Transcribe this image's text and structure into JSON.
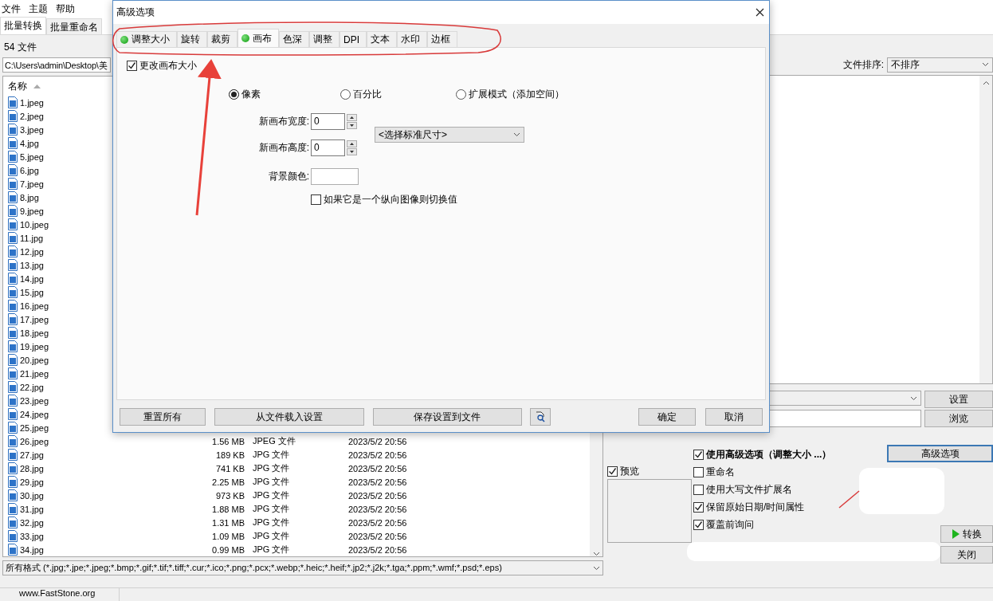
{
  "menu": [
    "文件",
    "主题",
    "帮助"
  ],
  "main_tabs": [
    {
      "label": "批量转换",
      "selected": true
    },
    {
      "label": "批量重命名",
      "selected": false
    }
  ],
  "file_count": "54 文件",
  "path": "C:\\Users\\admin\\Desktop\\美",
  "file_list": {
    "name_column": "名称",
    "rows": [
      {
        "name": "1.jpeg"
      },
      {
        "name": "2.jpeg"
      },
      {
        "name": "3.jpeg"
      },
      {
        "name": "4.jpg"
      },
      {
        "name": "5.jpeg"
      },
      {
        "name": "6.jpg"
      },
      {
        "name": "7.jpeg"
      },
      {
        "name": "8.jpg"
      },
      {
        "name": "9.jpeg"
      },
      {
        "name": "10.jpeg"
      },
      {
        "name": "11.jpg"
      },
      {
        "name": "12.jpg"
      },
      {
        "name": "13.jpg"
      },
      {
        "name": "14.jpg"
      },
      {
        "name": "15.jpg"
      },
      {
        "name": "16.jpeg"
      },
      {
        "name": "17.jpeg"
      },
      {
        "name": "18.jpeg"
      },
      {
        "name": "19.jpeg"
      },
      {
        "name": "20.jpeg"
      },
      {
        "name": "21.jpeg"
      },
      {
        "name": "22.jpg"
      },
      {
        "name": "23.jpeg"
      },
      {
        "name": "24.jpeg"
      },
      {
        "name": "25.jpeg"
      },
      {
        "name": "26.jpeg",
        "size": "1.56 MB",
        "type": "JPEG 文件",
        "date": "2023/5/2 20:56"
      },
      {
        "name": "27.jpg",
        "size": "189 KB",
        "type": "JPG 文件",
        "date": "2023/5/2 20:56"
      },
      {
        "name": "28.jpg",
        "size": "741 KB",
        "type": "JPG 文件",
        "date": "2023/5/2 20:56"
      },
      {
        "name": "29.jpg",
        "size": "2.25 MB",
        "type": "JPG 文件",
        "date": "2023/5/2 20:56"
      },
      {
        "name": "30.jpg",
        "size": "973 KB",
        "type": "JPG 文件",
        "date": "2023/5/2 20:56"
      },
      {
        "name": "31.jpg",
        "size": "1.88 MB",
        "type": "JPG 文件",
        "date": "2023/5/2 20:56"
      },
      {
        "name": "32.jpg",
        "size": "1.31 MB",
        "type": "JPG 文件",
        "date": "2023/5/2 20:56"
      },
      {
        "name": "33.jpg",
        "size": "1.09 MB",
        "type": "JPG 文件",
        "date": "2023/5/2 20:56"
      },
      {
        "name": "34.jpg",
        "size": "0.99 MB",
        "type": "JPG 文件",
        "date": "2023/5/2 20:56"
      }
    ]
  },
  "format_filter": "所有格式 (*.jpg;*.jpe;*.jpeg;*.bmp;*.gif;*.tif;*.tiff;*.cur;*.ico;*.png;*.pcx;*.webp;*.heic;*.heif;*.jp2;*.j2k;*.tga;*.ppm;*.wmf;*.psd;*.eps)",
  "status_bar": "www.FastStone.org",
  "output": {
    "sort_label": "文件排序:",
    "sort_value": "不排序",
    "settings_button": "设置",
    "browse_button": "浏览",
    "use_advanced": {
      "label": "使用高级选项（调整大小 ...）",
      "checked": true
    },
    "advanced_button": "高级选项",
    "preview": {
      "label": "预览",
      "checked": true
    },
    "options": [
      {
        "label": "重命名",
        "checked": false
      },
      {
        "label": "使用大写文件扩展名",
        "checked": false
      },
      {
        "label": "保留原始日期/时间属性",
        "checked": true
      },
      {
        "label": "覆盖前询问",
        "checked": true
      }
    ],
    "convert_button": "转换",
    "close_button": "关闭"
  },
  "dialog": {
    "title": "高级选项",
    "tabs": [
      {
        "label": "调整大小",
        "enabled": true,
        "selected": false
      },
      {
        "label": "旋转",
        "enabled": false,
        "selected": false
      },
      {
        "label": "裁剪",
        "enabled": false,
        "selected": false
      },
      {
        "label": "画布",
        "enabled": true,
        "selected": true
      },
      {
        "label": "色深",
        "enabled": false,
        "selected": false
      },
      {
        "label": "调整",
        "enabled": false,
        "selected": false
      },
      {
        "label": "DPI",
        "enabled": false,
        "selected": false
      },
      {
        "label": "文本",
        "enabled": false,
        "selected": false
      },
      {
        "label": "水印",
        "enabled": false,
        "selected": false
      },
      {
        "label": "边框",
        "enabled": false,
        "selected": false
      }
    ],
    "change_canvas": {
      "label": "更改画布大小",
      "checked": true
    },
    "units": [
      {
        "label": "像素",
        "selected": true
      },
      {
        "label": "百分比",
        "selected": false
      },
      {
        "label": "扩展模式（添加空间）",
        "selected": false
      }
    ],
    "width": {
      "label": "新画布宽度:",
      "value": "0"
    },
    "height": {
      "label": "新画布高度:",
      "value": "0"
    },
    "standard_size": "<选择标准尺寸>",
    "background": {
      "label": "背景颜色:",
      "color": "#ffffff"
    },
    "swap": {
      "label": "如果它是一个纵向图像则切换值",
      "checked": false
    },
    "buttons": [
      "重置所有",
      "从文件载入设置",
      "保存设置到文件"
    ],
    "ok_button": "确定",
    "cancel_button": "取消"
  }
}
